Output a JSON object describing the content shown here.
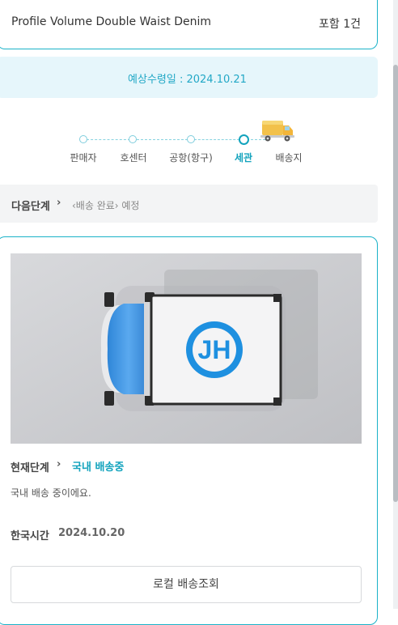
{
  "product": {
    "name": "Profile Volume Double Waist Denim",
    "count": "포함 1건"
  },
  "eta": {
    "text": "예상수령일 : 2024.10.21"
  },
  "progress": {
    "steps": [
      {
        "label": "판매자",
        "active": false
      },
      {
        "label": "호센터",
        "active": false
      },
      {
        "label": "공항(항구)",
        "active": false
      },
      {
        "label": "세관",
        "active": true
      },
      {
        "label": "배송지",
        "active": false
      }
    ],
    "current_icon": "delivery-truck-icon"
  },
  "next_step": {
    "label": "다음단계",
    "value": "‹배송 완료› 예정"
  },
  "current": {
    "label": "현재단계",
    "value": "국내 배송중",
    "description": "국내 배송 중이에요.",
    "korea_time_label": "한국시간",
    "korea_time_value": "2024.10.20"
  },
  "local_button": {
    "label": "로컬 배송조회"
  },
  "colors": {
    "accent": "#12a3bd",
    "banner_bg": "#e6f6fb",
    "truck_cab": "#3f95e3"
  }
}
